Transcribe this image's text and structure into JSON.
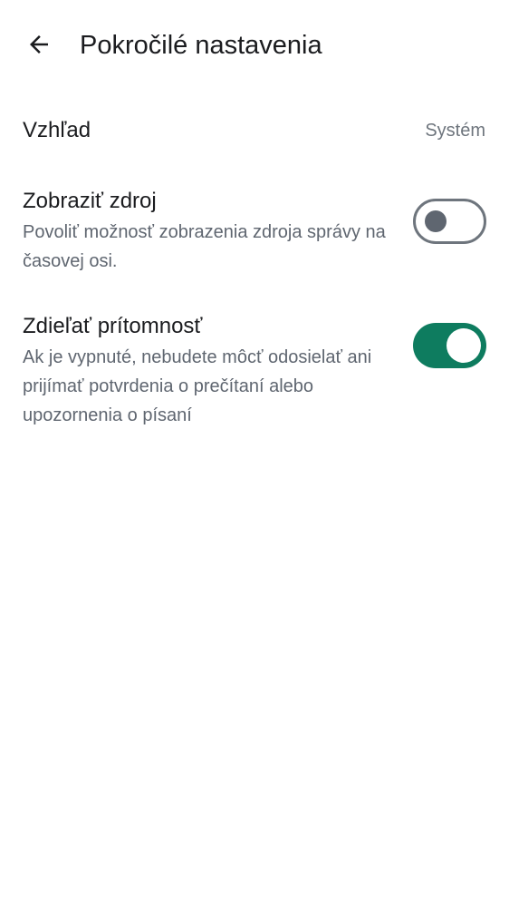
{
  "header": {
    "title": "Pokročilé nastavenia",
    "back_icon": "arrow-left-icon"
  },
  "settings": [
    {
      "title": "Vzhľad",
      "value": "Systém"
    },
    {
      "title": "Zobraziť zdroj",
      "description": "Povoliť možnosť zobrazenia zdroja správy na časovej osi.",
      "toggle_on": false
    },
    {
      "title": "Zdieľať prítomnosť",
      "description": "Ak je vypnuté, nebudete môcť odosielať ani prijímať potvrdenia o prečítaní alebo upozornenia o písaní",
      "toggle_on": true
    }
  ],
  "colors": {
    "accent": "#0e7c5f",
    "text_primary": "#1b1c1f",
    "text_secondary": "#5f6670"
  }
}
